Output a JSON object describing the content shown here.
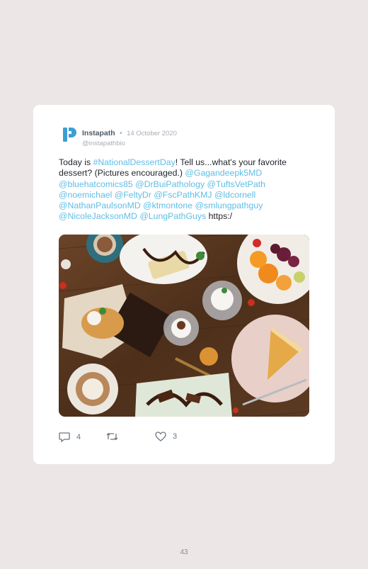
{
  "post": {
    "author_name": "Instapath",
    "separator": "•",
    "date": "14 October 2020",
    "handle": "@instapathbio",
    "text_segments": [
      {
        "text": "Today is ",
        "link": false
      },
      {
        "text": "#NationalDessertDay",
        "link": true
      },
      {
        "text": "! Tell us...what's your favorite dessert? (Pictures encouraged.) ",
        "link": false
      },
      {
        "text": "@Gagandeepk5MD",
        "link": true
      },
      {
        "text": " ",
        "link": false
      },
      {
        "text": "@bluehatcomics85",
        "link": true
      },
      {
        "text": " ",
        "link": false
      },
      {
        "text": "@DrBuiPathology",
        "link": true
      },
      {
        "text": " ",
        "link": false
      },
      {
        "text": "@TuftsVetPath",
        "link": true
      },
      {
        "text": " ",
        "link": false
      },
      {
        "text": "@noemichael",
        "link": true
      },
      {
        "text": " ",
        "link": false
      },
      {
        "text": "@FeltyDr",
        "link": true
      },
      {
        "text": " ",
        "link": false
      },
      {
        "text": "@FscPathKMJ",
        "link": true
      },
      {
        "text": " ",
        "link": false
      },
      {
        "text": "@ldcornell",
        "link": true
      },
      {
        "text": " ",
        "link": false
      },
      {
        "text": "@NathanPaulsonMD",
        "link": true
      },
      {
        "text": " ",
        "link": false
      },
      {
        "text": "@ktmontone",
        "link": true
      },
      {
        "text": " ",
        "link": false
      },
      {
        "text": "@smlungpathguy",
        "link": true
      },
      {
        "text": " ",
        "link": false
      },
      {
        "text": "@NicoleJacksonMD",
        "link": true
      },
      {
        "text": " ",
        "link": false
      },
      {
        "text": "@LungPathGuys",
        "link": true
      },
      {
        "text": " https:/",
        "link": false
      }
    ],
    "image_icon": "desserts-photo",
    "actions": {
      "reply": {
        "icon": "reply-icon",
        "count": "4"
      },
      "retweet": {
        "icon": "retweet-icon",
        "count": ""
      },
      "like": {
        "icon": "heart-icon",
        "count": "3"
      }
    }
  },
  "page_number": "43",
  "colors": {
    "background": "#ece7e6",
    "card": "#ffffff",
    "link": "#5fbde6",
    "logo": "#3b9fd3",
    "muted": "#a7aeb5"
  }
}
